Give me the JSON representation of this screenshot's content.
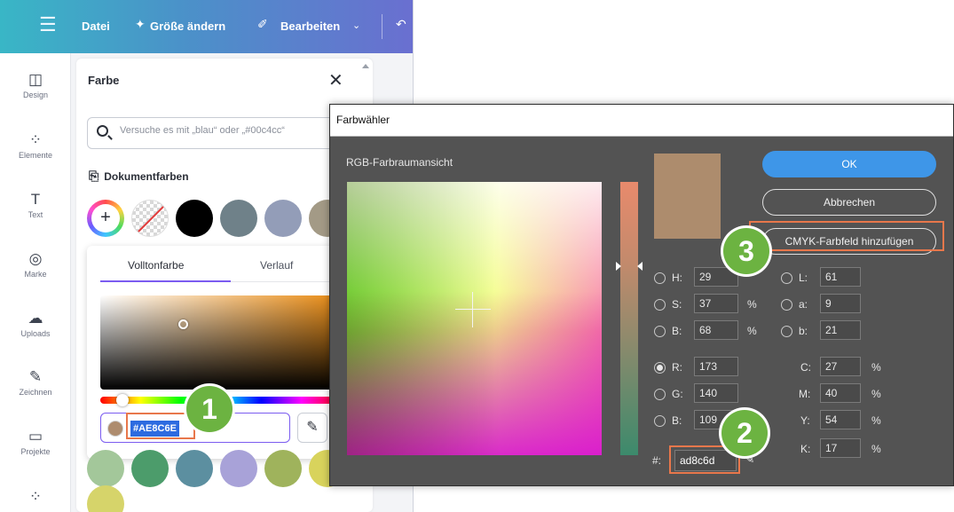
{
  "canva": {
    "topbar": {
      "menu_icon": "hamburger-icon",
      "file": "Datei",
      "resize": "Größe ändern",
      "resize_icon": "sparkle-icon",
      "edit": "Bearbeiten",
      "edit_icon": "pencil-icon",
      "undo_icon": "undo-icon"
    },
    "sidebar": [
      {
        "label": "Design",
        "icon": "layout-icon",
        "glyph": "◫"
      },
      {
        "label": "Elemente",
        "icon": "shapes-icon",
        "glyph": "⁘"
      },
      {
        "label": "Text",
        "icon": "text-icon",
        "glyph": "T"
      },
      {
        "label": "Marke",
        "icon": "brand-icon",
        "glyph": "◎"
      },
      {
        "label": "Uploads",
        "icon": "cloud-upload-icon",
        "glyph": "☁"
      },
      {
        "label": "Zeichnen",
        "icon": "draw-icon",
        "glyph": "✎"
      },
      {
        "label": "Projekte",
        "icon": "folder-icon",
        "glyph": "▭"
      },
      {
        "label": "",
        "icon": "apps-icon",
        "glyph": "⁘"
      }
    ],
    "panel": {
      "title": "Farbe",
      "close_icon": "close-icon",
      "search_placeholder": "Versuche es mit „blau“ oder „#00c4cc“",
      "doc_colors_title": "Dokumentfarben",
      "doc_colors": [
        "#000000",
        "#6f8189",
        "#939db8",
        "#a39a86"
      ],
      "tabs": [
        "Volltonfarbe",
        "Verlauf"
      ],
      "hex_value": "#AE8C6E",
      "selected_color": "#ae8c6e",
      "more_colors": [
        "#a3c79a",
        "#4c9c6b",
        "#5c8fa0",
        "#a8a2d8",
        "#9fb35c",
        "#d8d35c",
        "#d6d46a"
      ]
    }
  },
  "badges": [
    "1",
    "2",
    "3"
  ],
  "dialog": {
    "title": "Farbwähler",
    "view_label": "RGB-Farbraumansicht",
    "new_color": "#ad8c6d",
    "ok": "OK",
    "cancel": "Abbrechen",
    "add_cmyk": "CMYK-Farbfeld hinzufügen",
    "hsb": {
      "H": "29",
      "S": "37",
      "B": "68"
    },
    "lab": {
      "L": "61",
      "a": "9",
      "b": "21"
    },
    "rgb": {
      "R": "173",
      "G": "140",
      "B": "109"
    },
    "cmyk": {
      "C": "27",
      "M": "40",
      "Y": "54",
      "K": "17"
    },
    "hex_label": "#:",
    "hex": "ad8c6d",
    "labels": {
      "H": "H:",
      "S": "S:",
      "Bh": "B:",
      "L": "L:",
      "a": "a:",
      "b": "b:",
      "R": "R:",
      "G": "G:",
      "Br": "B:",
      "C": "C:",
      "M": "M:",
      "Y": "Y:",
      "K": "K:"
    },
    "percent": "%"
  }
}
